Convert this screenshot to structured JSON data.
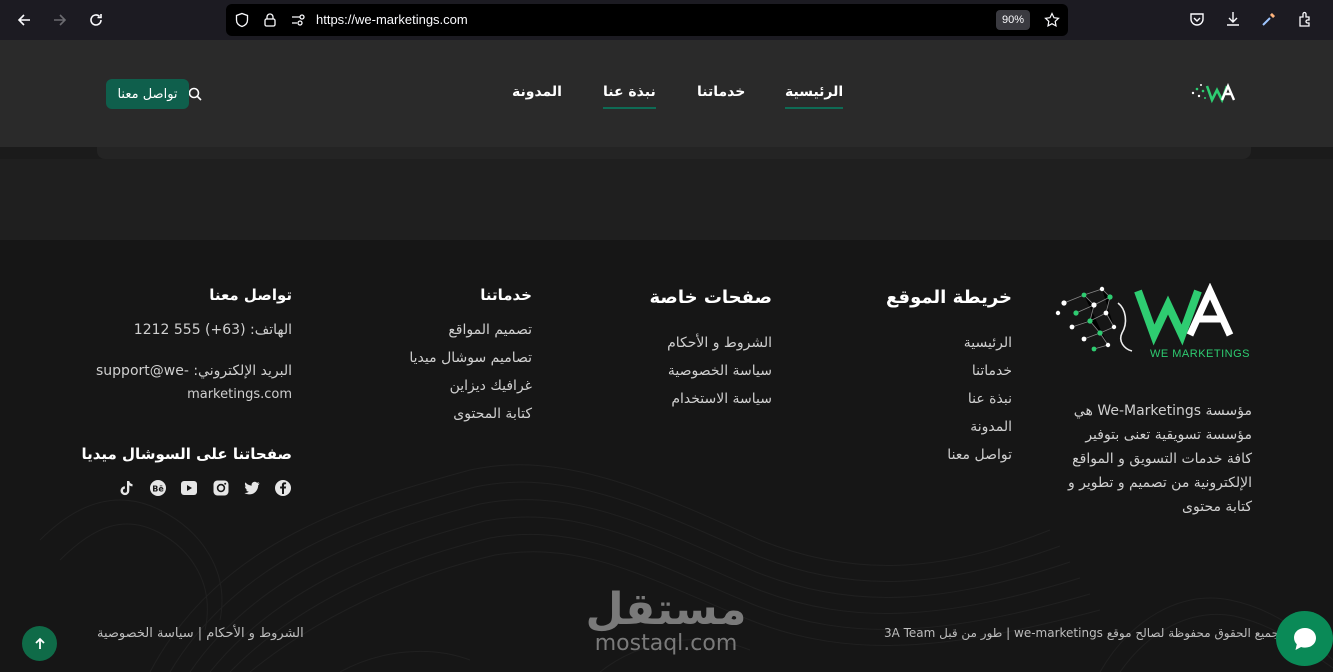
{
  "browser": {
    "url": "https://we-marketings.com",
    "zoom": "90%"
  },
  "header": {
    "nav": [
      "الرئيسية",
      "خدماتنا",
      "نبذة عنا",
      "المدونة"
    ],
    "contact_label": "تواصل معنا",
    "accent": "#0f5f4c"
  },
  "footer": {
    "about": "مؤسسة We-Marketings هي مؤسسة تسويقية تعنى بتوفير كافة خدمات التسويق و المواقع الإلكترونية من تصميم و تطوير و كتابة محتوى",
    "logo_text": "WE MARKETINGS",
    "sitemap": {
      "title": "خريطة الموقع",
      "links": [
        "الرئيسية",
        "خدماتنا",
        "نبذة عنا",
        "المدونة",
        "تواصل معنا"
      ]
    },
    "special": {
      "title": "صفحات خاصة",
      "links": [
        "الشروط و الأحكام",
        "سياسة الخصوصية",
        "سياسة الاستخدام"
      ]
    },
    "services": {
      "title": "خدماتنا",
      "links": [
        "تصميم المواقع",
        "تصاميم سوشال ميديا",
        "غرافيك ديزاين",
        "كتابة المحتوى"
      ]
    },
    "contact": {
      "title": "تواصل معنا",
      "phone": "الهاتف: (63+) 555 1212",
      "email_line1": "البريد الإلكتروني: -support@we",
      "email_line2": "marketings.com"
    },
    "social": {
      "title": "صفحاتنا على السوشال ميديا",
      "icons": [
        "facebook-icon",
        "twitter-icon",
        "instagram-icon",
        "youtube-icon",
        "behance-icon",
        "tiktok-icon"
      ]
    },
    "copyright": "جميع الحقوق محفوظة لصالح موقع we-marketings | طور من قبل 3A Team",
    "legal": "الشروط و الأحكام | سياسة الخصوصية"
  },
  "watermark": {
    "ar": "مستقل",
    "en": "mostaql.com"
  }
}
